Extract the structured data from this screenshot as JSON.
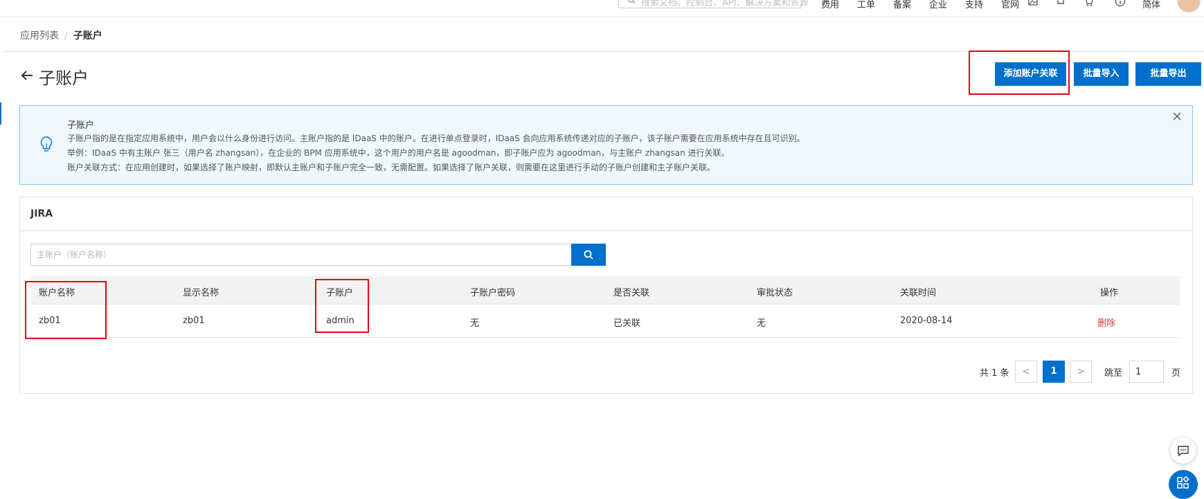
{
  "topbar": {
    "search_placeholder": "搜索文档、控制台、API、解决方案和资源",
    "nav": [
      "费用",
      "工单",
      "备案",
      "企业",
      "支持",
      "官网"
    ],
    "lang": "简体"
  },
  "breadcrumb": {
    "parent": "应用列表",
    "separator": "/",
    "current": "子账户"
  },
  "page": {
    "title": "子账户",
    "actions": {
      "add": "添加账户关联",
      "import": "批量导入",
      "export": "批量导出"
    }
  },
  "info": {
    "title": "子账户",
    "lines": [
      "子账户指的是在指定应用系统中，用户会以什么身份进行访问。主账户指的是 IDaaS 中的账户。在进行单点登录时，IDaaS 会向应用系统传递对应的子账户，该子账户需要在应用系统中存在且可识别。",
      "举例：IDaaS 中有主账户 张三（用户名 zhangsan），在企业的 BPM 应用系统中，这个用户的用户名是 agoodman，即子账户应为 agoodman，与主账户 zhangsan 进行关联。",
      "账户关联方式：在应用创建时，如果选择了账户映射，即默认主账户和子账户完全一致，无需配置。如果选择了账户关联，则需要在这里进行手动的子账户创建和主子账户关联。"
    ]
  },
  "panel": {
    "title": "JIRA",
    "search_placeholder": "主账户（账户名称）",
    "table": {
      "columns": [
        "账户名称",
        "显示名称",
        "子账户",
        "子账户密码",
        "是否关联",
        "审批状态",
        "关联时间",
        "操作"
      ],
      "rows": [
        {
          "account": "zb01",
          "display": "zb01",
          "sub": "admin",
          "password": "无",
          "linked": "已关联",
          "approval": "无",
          "time": "2020-08-14",
          "action": "删除"
        }
      ]
    },
    "pagination": {
      "total": "共 1 条",
      "prev": "<",
      "page": "1",
      "next": ">",
      "jump_label": "跳至",
      "jump_value": "1",
      "jump_unit": "页"
    }
  },
  "colors": {
    "primary": "#0070cc",
    "highlight": "#e60012",
    "danger": "#e0333b"
  }
}
